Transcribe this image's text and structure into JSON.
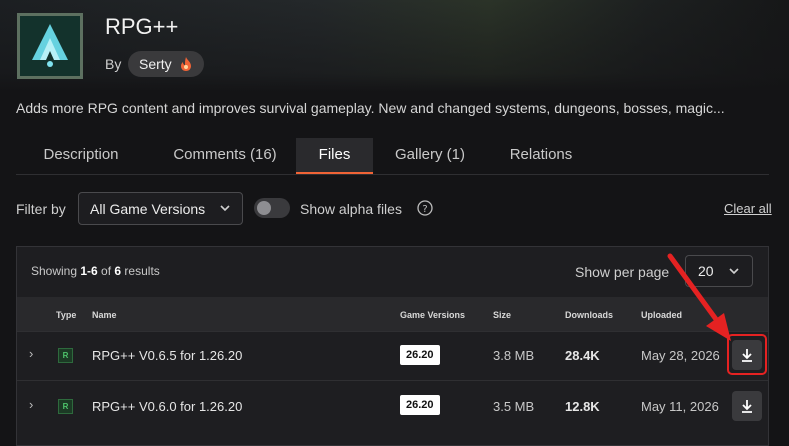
{
  "project": {
    "title": "RPG++",
    "by_label": "By",
    "author": "Serty",
    "description": "Adds more RPG content and improves survival gameplay. New and changed systems, dungeons, bosses, magic..."
  },
  "tabs": [
    {
      "label": "Description",
      "active": false
    },
    {
      "label": "Comments (16)",
      "active": false
    },
    {
      "label": "Files",
      "active": true
    },
    {
      "label": "Gallery (1)",
      "active": false
    },
    {
      "label": "Relations",
      "active": false
    }
  ],
  "filters": {
    "filter_label": "Filter by",
    "game_version_selected": "All Game Versions",
    "alpha_label": "Show alpha files",
    "alpha_enabled": false,
    "clear_label": "Clear all"
  },
  "results": {
    "showing_prefix": "Showing ",
    "range": "1-6",
    "of": " of ",
    "total": "6",
    "suffix": " results",
    "per_page_label": "Show per page",
    "per_page_value": "20"
  },
  "table": {
    "columns": {
      "type": "Type",
      "name": "Name",
      "game_versions": "Game Versions",
      "size": "Size",
      "downloads": "Downloads",
      "uploaded": "Uploaded"
    },
    "rows": [
      {
        "type": "R",
        "name": "RPG++ V0.6.5 for 1.26.20",
        "game_version": "26.20",
        "size": "3.8 MB",
        "downloads": "28.4K",
        "uploaded": "May 28, 2026"
      },
      {
        "type": "R",
        "name": "RPG++ V0.6.0 for 1.26.20",
        "game_version": "26.20",
        "size": "3.5 MB",
        "downloads": "12.8K",
        "uploaded": "May 11, 2026"
      }
    ]
  },
  "icons": {
    "expand": "›",
    "help": "?",
    "fire": "fire-icon",
    "download": "download-icon",
    "chevron": "chevron-down-icon"
  },
  "colors": {
    "accent": "#f16436",
    "release_green": "#4ec46b",
    "annotation_red": "#e52222"
  }
}
